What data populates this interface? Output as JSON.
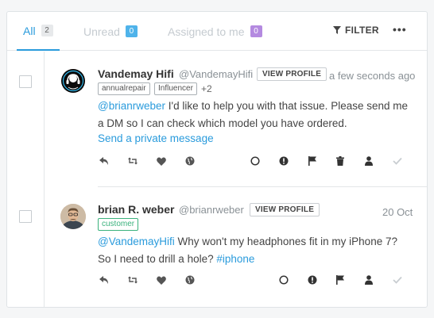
{
  "tabs": [
    {
      "label": "All",
      "count": "2"
    },
    {
      "label": "Unread",
      "count": "0"
    },
    {
      "label": "Assigned to me",
      "count": "0"
    }
  ],
  "toolbar": {
    "filter_label": "FILTER",
    "more_label": "•••"
  },
  "messages": [
    {
      "name": "Vandemay Hifi",
      "handle": "@VandemayHifi",
      "view_profile": "VIEW PROFILE",
      "time": "a few seconds ago",
      "tags": [
        "annualrepair",
        "Influencer"
      ],
      "tags_more": "+2",
      "line1_mention": "@brianrweber",
      "line1_text": " I'd like to help you with that issue. Please send me",
      "line2_text": "a DM so I can check which model you have ordered.",
      "private_message": "Send a private message"
    },
    {
      "name": "brian R. weber",
      "handle": "@brianrweber",
      "view_profile": "VIEW PROFILE",
      "time": "20 Oct",
      "tags": [
        "customer"
      ],
      "line1_mention": "@VandemayHifi",
      "line1_text": " Why won't my headphones fit in my iPhone 7?",
      "line2_text": "So I need to drill a hole? ",
      "line2_hashtag": "#iphone"
    }
  ],
  "icons": [
    "reply-icon",
    "retweet-icon",
    "like-icon",
    "globe-icon",
    "status-circle-icon",
    "priority-icon",
    "flag-icon",
    "trash-icon",
    "assign-user-icon",
    "check-icon"
  ],
  "colors": {
    "accent": "#2a9bdc",
    "unread_badge": "#4fb3ea",
    "assigned_badge": "#b48ae0",
    "customer_tag": "#3bb27d"
  }
}
